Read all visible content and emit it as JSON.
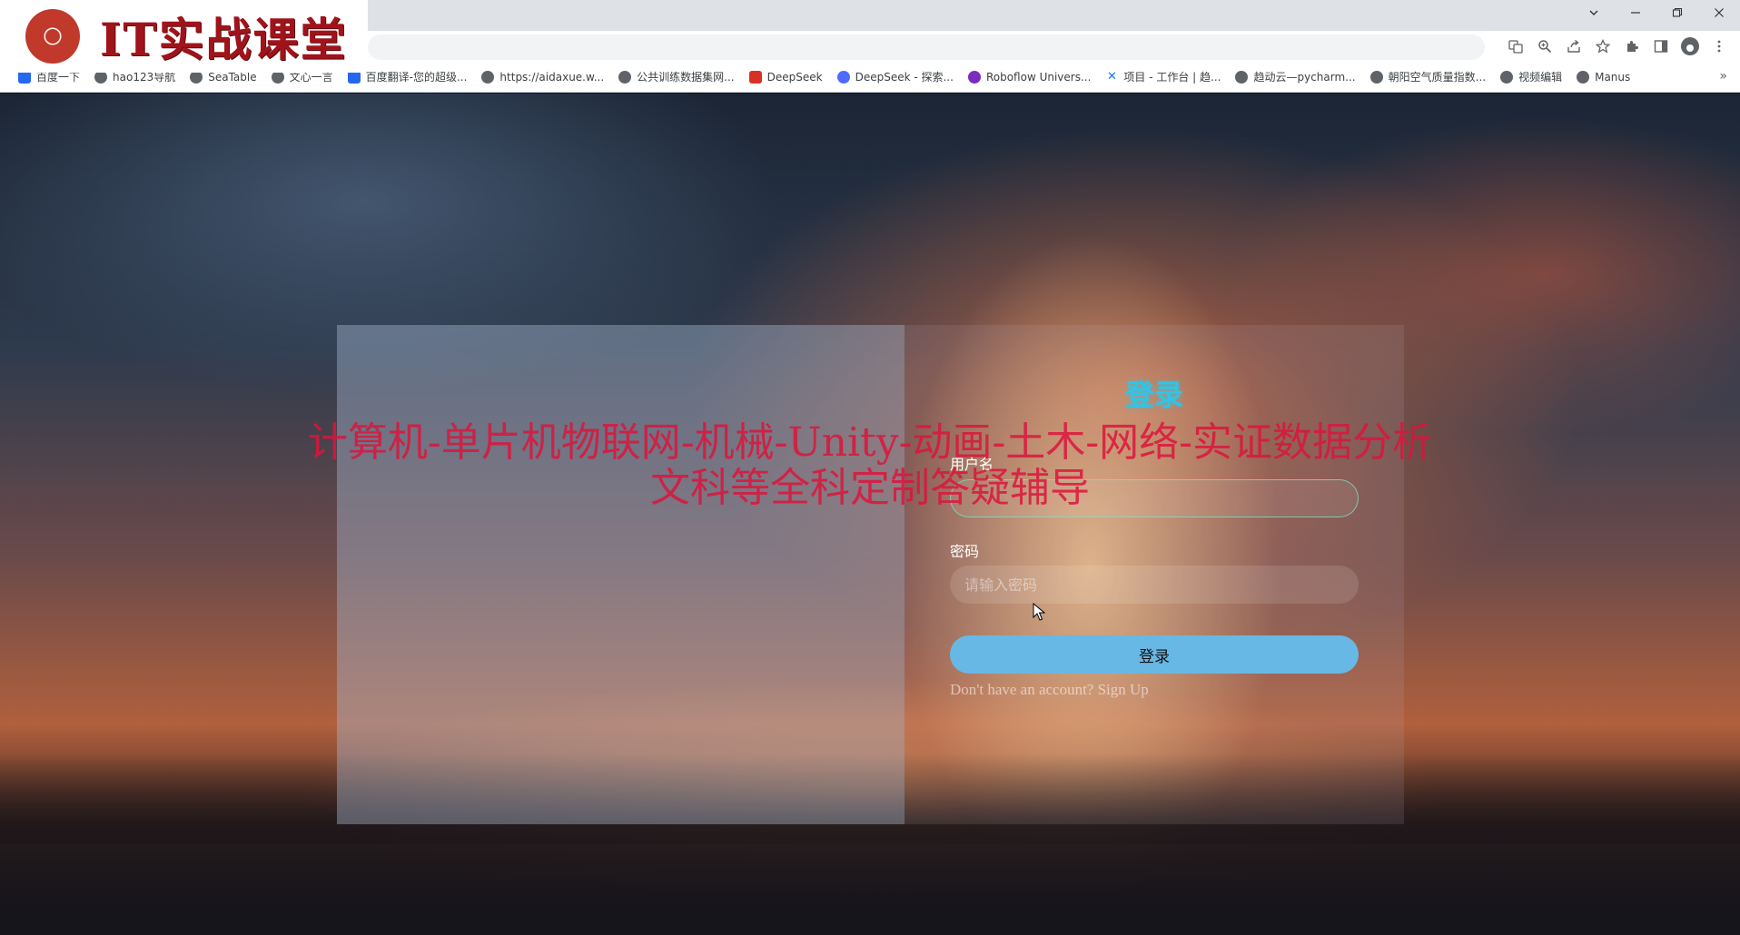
{
  "logo": {
    "text": "IT实战课堂"
  },
  "window_controls": [
    "chevron-down",
    "minimize",
    "restore",
    "close"
  ],
  "bookmarks": [
    {
      "label": "百度一下",
      "icon": "baidu-icon"
    },
    {
      "label": "hao123导航",
      "icon": "globe-icon"
    },
    {
      "label": "SeaTable",
      "icon": "globe-icon"
    },
    {
      "label": "文心一言",
      "icon": "globe-icon"
    },
    {
      "label": "百度翻译-您的超级...",
      "icon": "baidu-translate-icon"
    },
    {
      "label": "https://aidaxue.w...",
      "icon": "globe-icon"
    },
    {
      "label": "公共训练数据集网...",
      "icon": "globe-icon"
    },
    {
      "label": "DeepSeek",
      "icon": "deepseek-icon"
    },
    {
      "label": "DeepSeek - 探索...",
      "icon": "deepseek-icon"
    },
    {
      "label": "Roboflow Univers...",
      "icon": "roboflow-icon"
    },
    {
      "label": "项目 - 工作台 | 趋...",
      "icon": "x-icon"
    },
    {
      "label": "趋动云—pycharm...",
      "icon": "globe-icon"
    },
    {
      "label": "朝阳空气质量指数...",
      "icon": "globe-icon"
    },
    {
      "label": "视频编辑",
      "icon": "globe-icon"
    },
    {
      "label": "Manus",
      "icon": "manus-icon"
    }
  ],
  "login": {
    "title": "登录",
    "username_label": "用户名",
    "username_value": "",
    "password_label": "密码",
    "password_placeholder": "请输入密码",
    "submit_label": "登录",
    "signup_text": "Don't have an account? Sign Up"
  },
  "watermark": {
    "line1": "计算机-单片机物联网-机械-Unity-动画-土木-网络-实证数据分析",
    "line2": "文科等全科定制答疑辅导"
  }
}
